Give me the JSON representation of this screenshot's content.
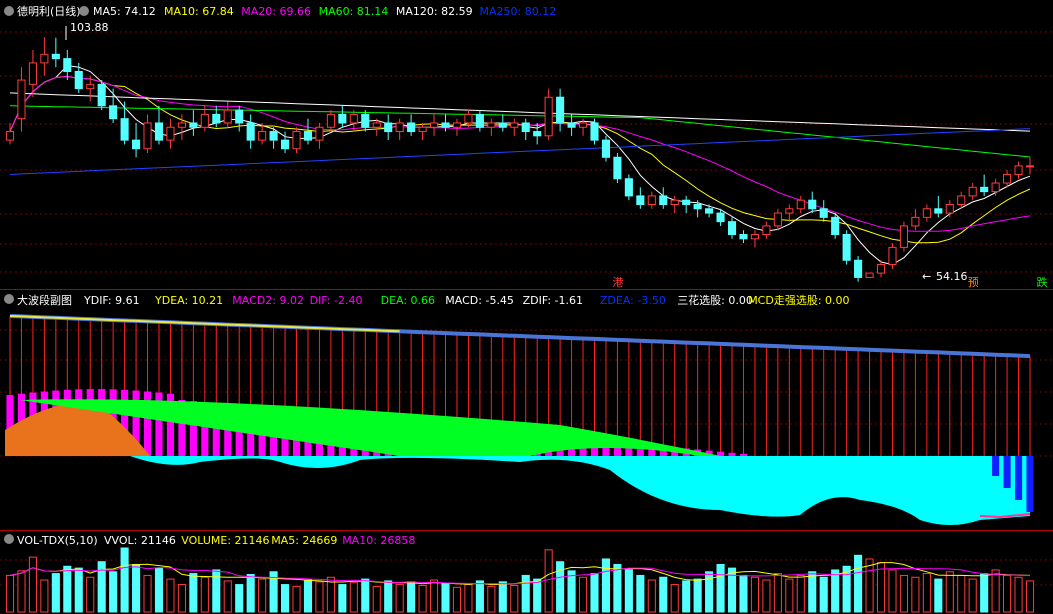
{
  "stock": {
    "title": "德明利(日线)",
    "ma_legend": [
      {
        "label": "MA5: 74.12",
        "color": "#ffffff"
      },
      {
        "label": "MA10: 67.84",
        "color": "#ffff00"
      },
      {
        "label": "MA20: 69.66",
        "color": "#ff00ff"
      },
      {
        "label": "MA60: 81.14",
        "color": "#00ff00"
      },
      {
        "label": "MA120: 82.59",
        "color": "#ffffff"
      },
      {
        "label": "MA250: 80.12",
        "color": "#0033ff"
      }
    ],
    "high_label": "103.88",
    "low_label": "54.16",
    "signals": [
      {
        "text": "港",
        "color": "#ff3333",
        "bar": 53
      },
      {
        "text": "预",
        "color": "#ff8800",
        "bar": 84
      },
      {
        "text": "跌",
        "color": "#00ff00",
        "bar": 90
      }
    ]
  },
  "indicator": {
    "title": "大波段副图",
    "legend": [
      {
        "label": "YDIF: 9.61",
        "color": "#ffffff"
      },
      {
        "label": "YDEA: 10.21",
        "color": "#ffff00"
      },
      {
        "label": "MACD2: 9.02",
        "color": "#ff00ff"
      },
      {
        "label": "DIF: -2.40",
        "color": "#ff00ff"
      },
      {
        "label": "DEA: 0.66",
        "color": "#00ff00"
      },
      {
        "label": "MACD: -5.45",
        "color": "#ffffff"
      },
      {
        "label": "ZDIF: -1.61",
        "color": "#ffffff"
      },
      {
        "label": "ZDEA: -3.50",
        "color": "#0033ff"
      },
      {
        "label": "三花选股: 0.00",
        "color": "#ffffff"
      },
      {
        "label": "MCD走强选股: 0.00",
        "color": "#ffff00"
      }
    ]
  },
  "volume": {
    "title": "VOL-TDX(5,10)",
    "legend": [
      {
        "label": "VVOL: 21146",
        "color": "#ffffff"
      },
      {
        "label": "VOLUME: 21146",
        "color": "#ffff00"
      },
      {
        "label": "MA5: 24669",
        "color": "#ffff00"
      },
      {
        "label": "MA10: 26858",
        "color": "#ff00ff"
      }
    ]
  },
  "colors": {
    "up": "#ff3c3c",
    "down": "#54ffff",
    "grid": "#7a0000",
    "divider": "#b00000"
  },
  "chart_data": {
    "type": "candlestick",
    "ohlc": [
      [
        80,
        84,
        79,
        82
      ],
      [
        85,
        97,
        82,
        94
      ],
      [
        93,
        101,
        90,
        98
      ],
      [
        98,
        104,
        95,
        100
      ],
      [
        100,
        103.88,
        97,
        99
      ],
      [
        99,
        101,
        94,
        96
      ],
      [
        96,
        98,
        91,
        92
      ],
      [
        92,
        95,
        89,
        93
      ],
      [
        93,
        94,
        87,
        88
      ],
      [
        88,
        92,
        84,
        85
      ],
      [
        85,
        89,
        79,
        80
      ],
      [
        80,
        84,
        76,
        78
      ],
      [
        78,
        86,
        77,
        84
      ],
      [
        84,
        88,
        79,
        80
      ],
      [
        80,
        85,
        78,
        83
      ],
      [
        83,
        86,
        80,
        84
      ],
      [
        84,
        87,
        81,
        83
      ],
      [
        83,
        88,
        82,
        86
      ],
      [
        86,
        88,
        83,
        84
      ],
      [
        84,
        89,
        83,
        87
      ],
      [
        87,
        88,
        82,
        84
      ],
      [
        84,
        86,
        78,
        80
      ],
      [
        80,
        84,
        79,
        82
      ],
      [
        82,
        83,
        78,
        80
      ],
      [
        80,
        82,
        77,
        78
      ],
      [
        78,
        83,
        77,
        82
      ],
      [
        82,
        85,
        79,
        80
      ],
      [
        80,
        84,
        78,
        83
      ],
      [
        83,
        87,
        82,
        86
      ],
      [
        86,
        88,
        83,
        84
      ],
      [
        84,
        87,
        82,
        86
      ],
      [
        86,
        87,
        82,
        83
      ],
      [
        83,
        85,
        81,
        84
      ],
      [
        84,
        86,
        80,
        82
      ],
      [
        82,
        85,
        80,
        84
      ],
      [
        84,
        86,
        81,
        82
      ],
      [
        82,
        84,
        80,
        83
      ],
      [
        83,
        86,
        81,
        84
      ],
      [
        84,
        86,
        82,
        83
      ],
      [
        83,
        85,
        81,
        84
      ],
      [
        84,
        87,
        83,
        86
      ],
      [
        86,
        87,
        82,
        83
      ],
      [
        83,
        85,
        81,
        84
      ],
      [
        84,
        86,
        82,
        83
      ],
      [
        83,
        85,
        81,
        84
      ],
      [
        84,
        85,
        80,
        82
      ],
      [
        82,
        84,
        79,
        81
      ],
      [
        81,
        92,
        80,
        90
      ],
      [
        90,
        92,
        82,
        84
      ],
      [
        84,
        86,
        81,
        83
      ],
      [
        83,
        85,
        81,
        84
      ],
      [
        84,
        85,
        79,
        80
      ],
      [
        80,
        81,
        75,
        76
      ],
      [
        76,
        77,
        70,
        71
      ],
      [
        71,
        72,
        66,
        67
      ],
      [
        67,
        69,
        64,
        65
      ],
      [
        65,
        68,
        64,
        67
      ],
      [
        67,
        69,
        64,
        65
      ],
      [
        65,
        67,
        63,
        66
      ],
      [
        66,
        67,
        63,
        65
      ],
      [
        65,
        66,
        62,
        64
      ],
      [
        64,
        65,
        62,
        63
      ],
      [
        63,
        64,
        60,
        61
      ],
      [
        61,
        62,
        57,
        58
      ],
      [
        58,
        59,
        56,
        57
      ],
      [
        57,
        59,
        55,
        58
      ],
      [
        58,
        61,
        57,
        60
      ],
      [
        60,
        64,
        59,
        63
      ],
      [
        63,
        65,
        61,
        64
      ],
      [
        64,
        67,
        63,
        66
      ],
      [
        66,
        68,
        63,
        64
      ],
      [
        64,
        66,
        61,
        62
      ],
      [
        62,
        63,
        57,
        58
      ],
      [
        58,
        59,
        51,
        52
      ],
      [
        52,
        53,
        47,
        48
      ],
      [
        48,
        49,
        54.16,
        49
      ],
      [
        49,
        52,
        48,
        51
      ],
      [
        51,
        56,
        50,
        55
      ],
      [
        55,
        61,
        54,
        60
      ],
      [
        60,
        64,
        59,
        62
      ],
      [
        62,
        65,
        61,
        64
      ],
      [
        64,
        67,
        62,
        63
      ],
      [
        63,
        66,
        62,
        65
      ],
      [
        65,
        68,
        64,
        67
      ],
      [
        67,
        70,
        66,
        69
      ],
      [
        69,
        72,
        67,
        68
      ],
      [
        68,
        71,
        67,
        70
      ],
      [
        70,
        73,
        69,
        72
      ],
      [
        72,
        75,
        71,
        74
      ],
      [
        74,
        76,
        72,
        74
      ]
    ],
    "volume": [
      40,
      45,
      60,
      35,
      42,
      50,
      48,
      38,
      55,
      44,
      70,
      52,
      40,
      48,
      36,
      30,
      42,
      38,
      46,
      34,
      30,
      41,
      36,
      44,
      30,
      28,
      35,
      33,
      38,
      30,
      32,
      36,
      28,
      34,
      30,
      33,
      29,
      35,
      31,
      27,
      30,
      34,
      28,
      33,
      29,
      40,
      36,
      68,
      55,
      45,
      38,
      42,
      58,
      52,
      46,
      40,
      35,
      38,
      30,
      34,
      36,
      44,
      52,
      48,
      40,
      38,
      35,
      42,
      36,
      40,
      44,
      38,
      46,
      50,
      62,
      58,
      54,
      46,
      40,
      38,
      42,
      36,
      44,
      40,
      36,
      42,
      46,
      40,
      38,
      34
    ],
    "price_range": [
      46,
      108
    ],
    "indicator_range": [
      -10,
      12
    ]
  }
}
